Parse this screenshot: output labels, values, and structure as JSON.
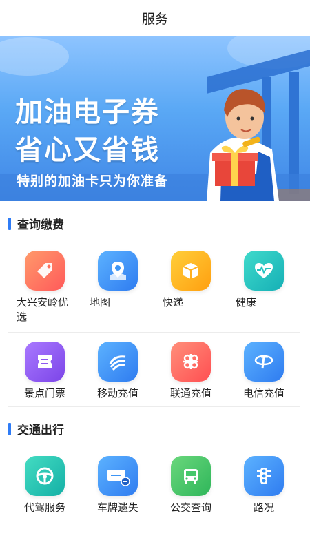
{
  "header": {
    "title": "服务"
  },
  "banner": {
    "line1": "加油电子券",
    "line2": "省心又省钱",
    "subtitle": "特别的加油卡只为你准备"
  },
  "sections": [
    {
      "title": "查询缴费",
      "rows": [
        [
          {
            "label": "大兴安岭优选",
            "icon": "tag-icon",
            "color": "#ff6e5a"
          },
          {
            "label": "地图",
            "icon": "map-icon",
            "color": "#3d95f5"
          },
          {
            "label": "快递",
            "icon": "package-icon",
            "color": "#ffb01f"
          },
          {
            "label": "健康",
            "icon": "heart-pulse-icon",
            "color": "#22c3c0"
          }
        ],
        [
          {
            "label": "景点门票",
            "icon": "ticket-icon",
            "color": "#8f58f0"
          },
          {
            "label": "移动充值",
            "icon": "china-mobile-icon",
            "color": "#3393f5"
          },
          {
            "label": "联通充值",
            "icon": "china-unicom-icon",
            "color": "#ff6b62"
          },
          {
            "label": "电信充值",
            "icon": "china-telecom-icon",
            "color": "#2f8ff5"
          }
        ]
      ]
    },
    {
      "title": "交通出行",
      "rows": [
        [
          {
            "label": "代驾服务",
            "icon": "steering-wheel-icon",
            "color": "#22c3b4"
          },
          {
            "label": "车牌遗失",
            "icon": "license-plate-icon",
            "color": "#3d95f5"
          },
          {
            "label": "公交查询",
            "icon": "bus-icon",
            "color": "#45c86a"
          },
          {
            "label": "路况",
            "icon": "traffic-light-icon",
            "color": "#3393f5"
          }
        ]
      ]
    }
  ]
}
